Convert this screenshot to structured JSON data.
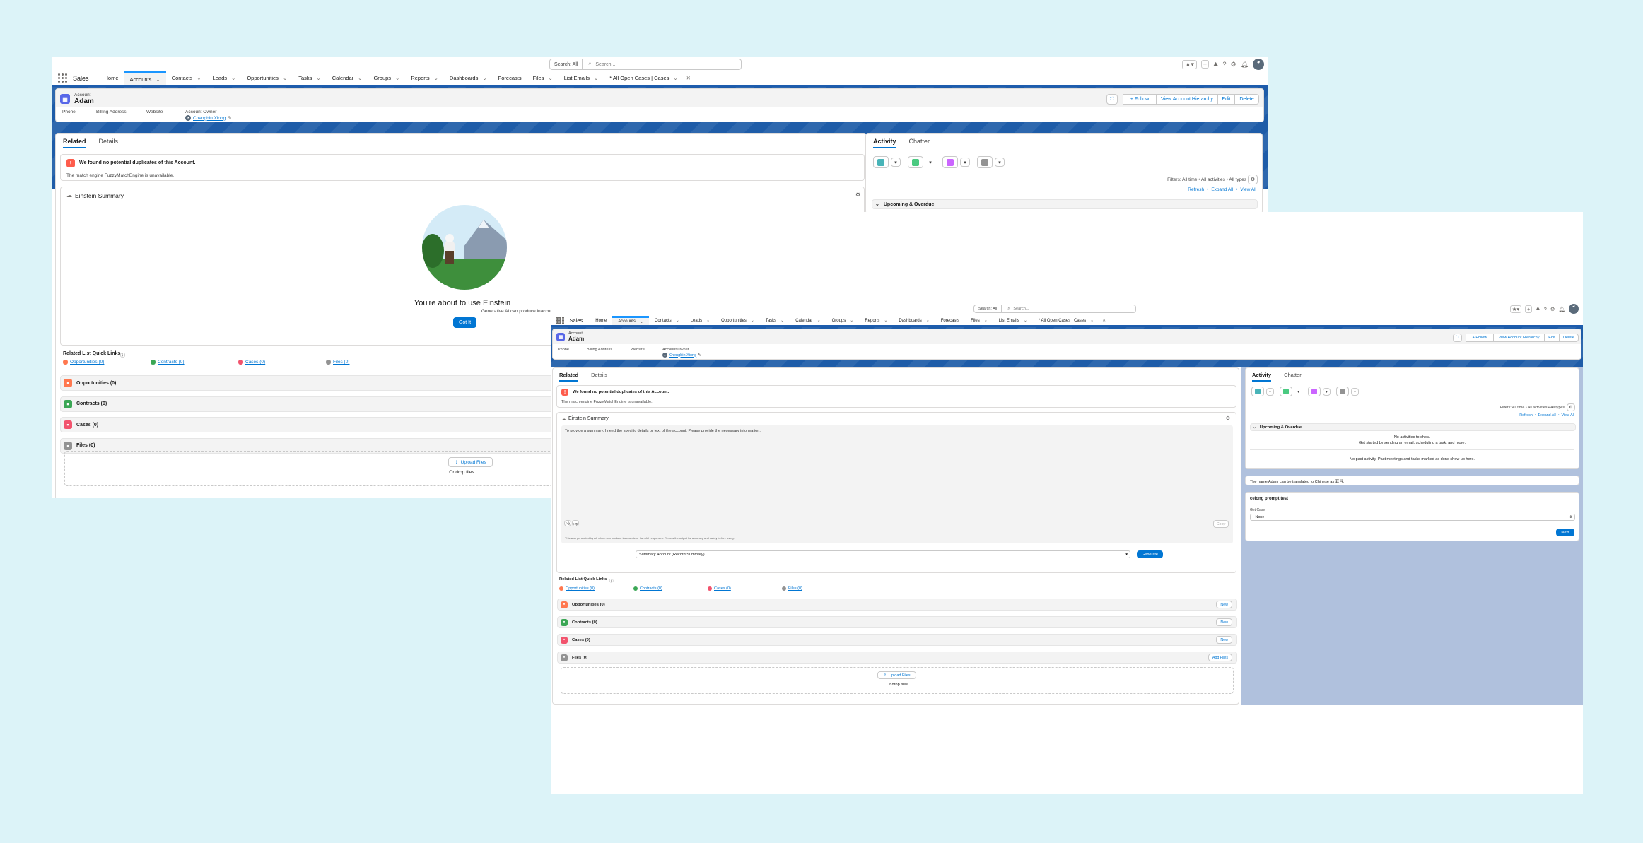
{
  "app": {
    "name": "Sales",
    "search_scope": "Search: All",
    "search_placeholder": "Search...",
    "nav": [
      {
        "label": "Home",
        "menu": false
      },
      {
        "label": "Accounts",
        "menu": true
      },
      {
        "label": "Contacts",
        "menu": true
      },
      {
        "label": "Leads",
        "menu": true
      },
      {
        "label": "Opportunities",
        "menu": true
      },
      {
        "label": "Tasks",
        "menu": true
      },
      {
        "label": "Calendar",
        "menu": true
      },
      {
        "label": "Groups",
        "menu": true
      },
      {
        "label": "Reports",
        "menu": true
      },
      {
        "label": "Dashboards",
        "menu": true
      },
      {
        "label": "Forecasts",
        "menu": false
      },
      {
        "label": "Files",
        "menu": true
      },
      {
        "label": "List Emails",
        "menu": true
      },
      {
        "label": "* All Open Cases | Cases",
        "menu": true
      }
    ]
  },
  "record": {
    "object": "Account",
    "name": "Adam",
    "fields": {
      "phone": "Phone",
      "billing": "Billing Address",
      "website": "Website",
      "owner_label": "Account Owner",
      "owner_name": "Chengbin Xiong"
    },
    "actions": {
      "follow": "+ Follow",
      "hierarchy": "View Account Hierarchy",
      "edit": "Edit",
      "delete": "Delete"
    }
  },
  "tabs": {
    "related": "Related",
    "details": "Details",
    "activity": "Activity",
    "chatter": "Chatter"
  },
  "duplicates": {
    "title": "We found no potential duplicates of this Account.",
    "body": "The match engine FuzzyMatchEngine is unavailable."
  },
  "einstein": {
    "title": "Einstein Summary",
    "heading": "You're about to use Einstein",
    "body": "Generative AI can produce inaccurate or harmful responses. Review output for accuracy and safety. You assume responsibility for how the ou",
    "got_it": "Got It",
    "summary_text": "To provide a summary, I need the specific details or text of the account. Please provide the necessary information.",
    "copy": "Copy",
    "disclaimer": "This was generated by AI, which can produce inaccurate or harmful responses. Review the output for accuracy and safety before using.",
    "prompt_select": "Summary Account (Record Summary)",
    "generate": "Generate"
  },
  "related": {
    "quick_links_title": "Related List Quick Links",
    "quick_links": [
      {
        "label": "Opportunities (0)",
        "color": "#ff784f"
      },
      {
        "label": "Contracts (0)",
        "color": "#3ba755"
      },
      {
        "label": "Cases (0)",
        "color": "#f2536d"
      },
      {
        "label": "Files (0)",
        "color": "#939393"
      }
    ],
    "sections": [
      {
        "label": "Opportunities (0)",
        "color": "#ff784f",
        "icon": "opportunity-icon",
        "action": "New"
      },
      {
        "label": "Contracts (0)",
        "color": "#3ba755",
        "icon": "contract-icon",
        "action": "New"
      },
      {
        "label": "Cases (0)",
        "color": "#f2536d",
        "icon": "case-icon",
        "action": "New"
      },
      {
        "label": "Files (0)",
        "color": "#939393",
        "icon": "file-icon",
        "action": "Add Files"
      }
    ],
    "upload": "Upload Files",
    "drop": "Or drop files"
  },
  "activity": {
    "filters": "Filters: All time • All activities • All types",
    "refresh": "Refresh",
    "expand": "Expand All",
    "view_all": "View All",
    "upcoming": "Upcoming & Overdue",
    "no_activities": "No activities to show.",
    "get_started": "Get started by sending an email, scheduling a task, and more.",
    "no_past": "No past activity. Past meetings and tasks marked as done show up here.",
    "translation": "The name Adam can be translated to Chinese as 亚当.",
    "prompt_card_title": "celong prompt test",
    "get_case_label": "Get Case",
    "get_case_value": "--None--",
    "next": "Next"
  },
  "colors": {
    "brand": "#0176d3",
    "nav_active": "#1b96ff",
    "band": "#1e5ca8",
    "account_icon": "#5867e8",
    "w2_right_bg": "#b0c1dd"
  }
}
